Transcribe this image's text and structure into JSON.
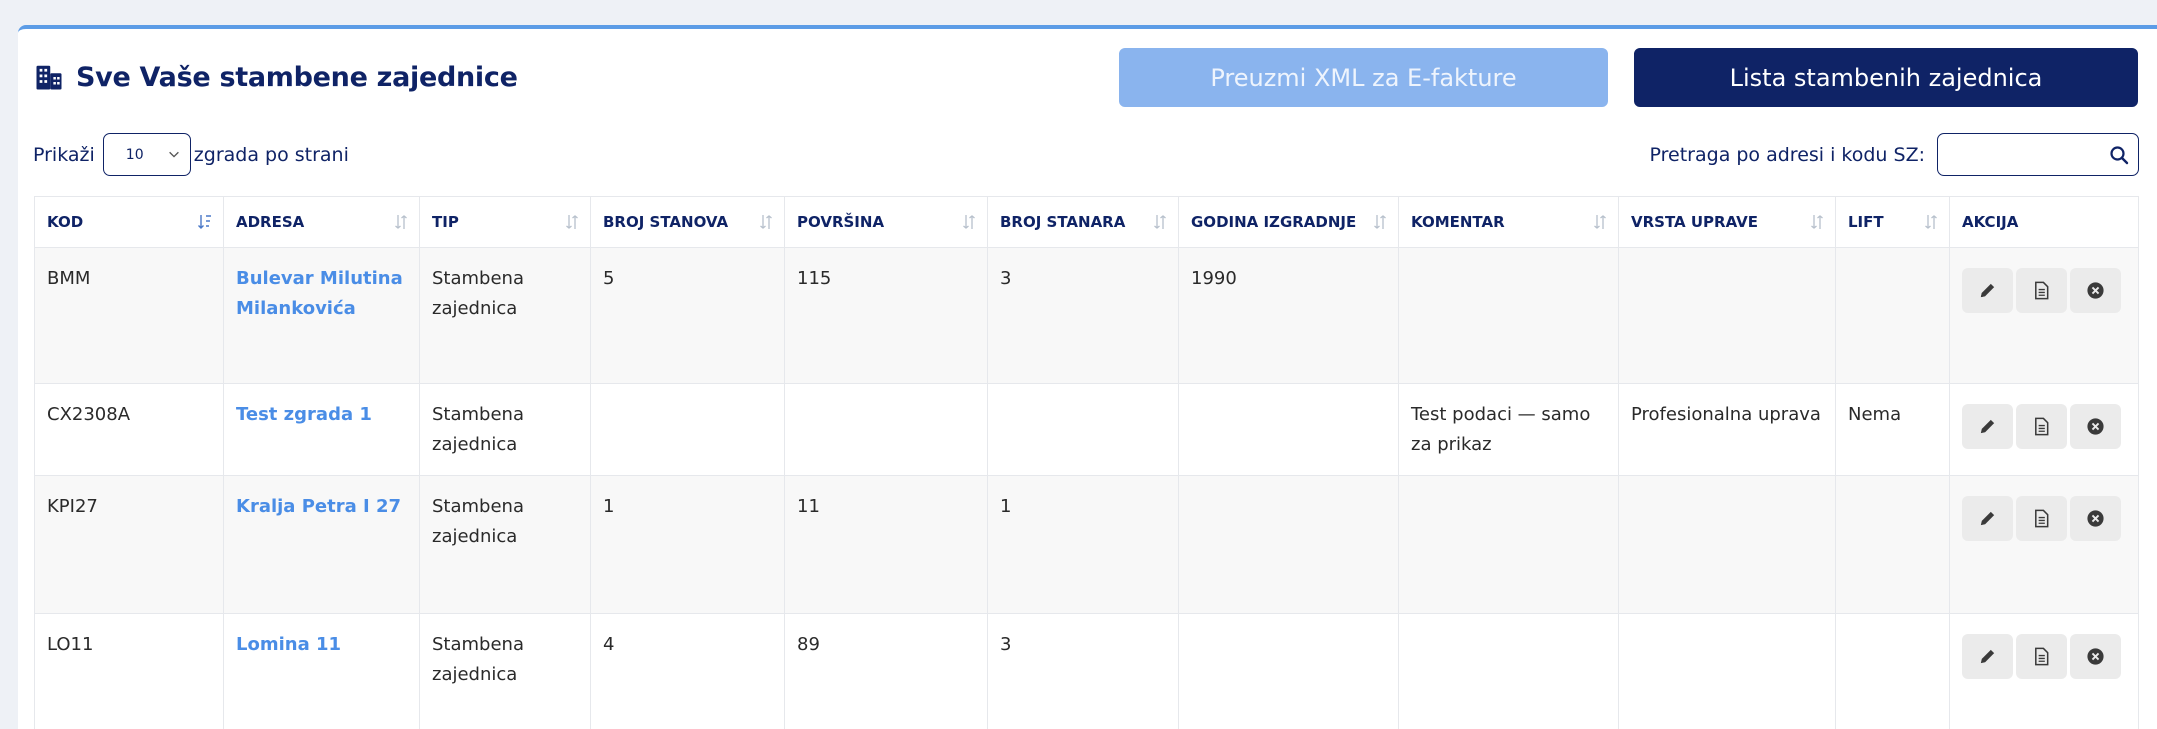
{
  "colors": {
    "brand_navy": "#0f2366",
    "accent_blue": "#5c9ce6",
    "link_blue": "#4a8de6",
    "disabled_blue": "#8ab4ee"
  },
  "header": {
    "title": "Sve Vaše stambene zajednice",
    "title_icon": "buildings-icon",
    "xml_button": "Preuzmi XML za E-fakture",
    "list_button": "Lista stambenih zajednica"
  },
  "length_control": {
    "prefix": "Prikaži",
    "value": "10",
    "suffix": "zgrada po strani"
  },
  "search": {
    "label": "Pretraga po adresi i kodu SZ:",
    "value": "",
    "icon": "search-icon"
  },
  "table": {
    "columns": [
      "KOD",
      "ADRESA",
      "TIP",
      "BROJ STANOVA",
      "POVRŠINA",
      "BROJ STANARA",
      "GODINA IZGRADNJE",
      "KOMENTAR",
      "VRSTA UPRAVE",
      "LIFT",
      "AKCIJA"
    ],
    "rows": [
      {
        "kod": "BMM",
        "adresa": "Bulevar Milutina Milankovića",
        "tip": "Stambena zajednica",
        "broj_stanova": "5",
        "povrsina": "115",
        "broj_stanara": "3",
        "godina": "1990",
        "komentar": "",
        "vrsta_uprave": "",
        "lift": ""
      },
      {
        "kod": "CX2308A",
        "adresa": "Test zgrada 1",
        "tip": "Stambena zajednica",
        "broj_stanova": "",
        "povrsina": "",
        "broj_stanara": "",
        "godina": "",
        "komentar": "Test podaci — samo za prikaz",
        "vrsta_uprave": "Profesionalna uprava",
        "lift": "Nema"
      },
      {
        "kod": "KPI27",
        "adresa": "Kralja Petra I 27",
        "tip": "Stambena zajednica",
        "broj_stanova": "1",
        "povrsina": "11",
        "broj_stanara": "1",
        "godina": "",
        "komentar": "",
        "vrsta_uprave": "",
        "lift": ""
      },
      {
        "kod": "LO11",
        "adresa": "Lomina 11",
        "tip": "Stambena zajednica",
        "broj_stanova": "4",
        "povrsina": "89",
        "broj_stanara": "3",
        "godina": "",
        "komentar": "",
        "vrsta_uprave": "",
        "lift": ""
      }
    ],
    "action_icons": [
      "pencil-icon",
      "document-icon",
      "close-circle-icon"
    ]
  }
}
